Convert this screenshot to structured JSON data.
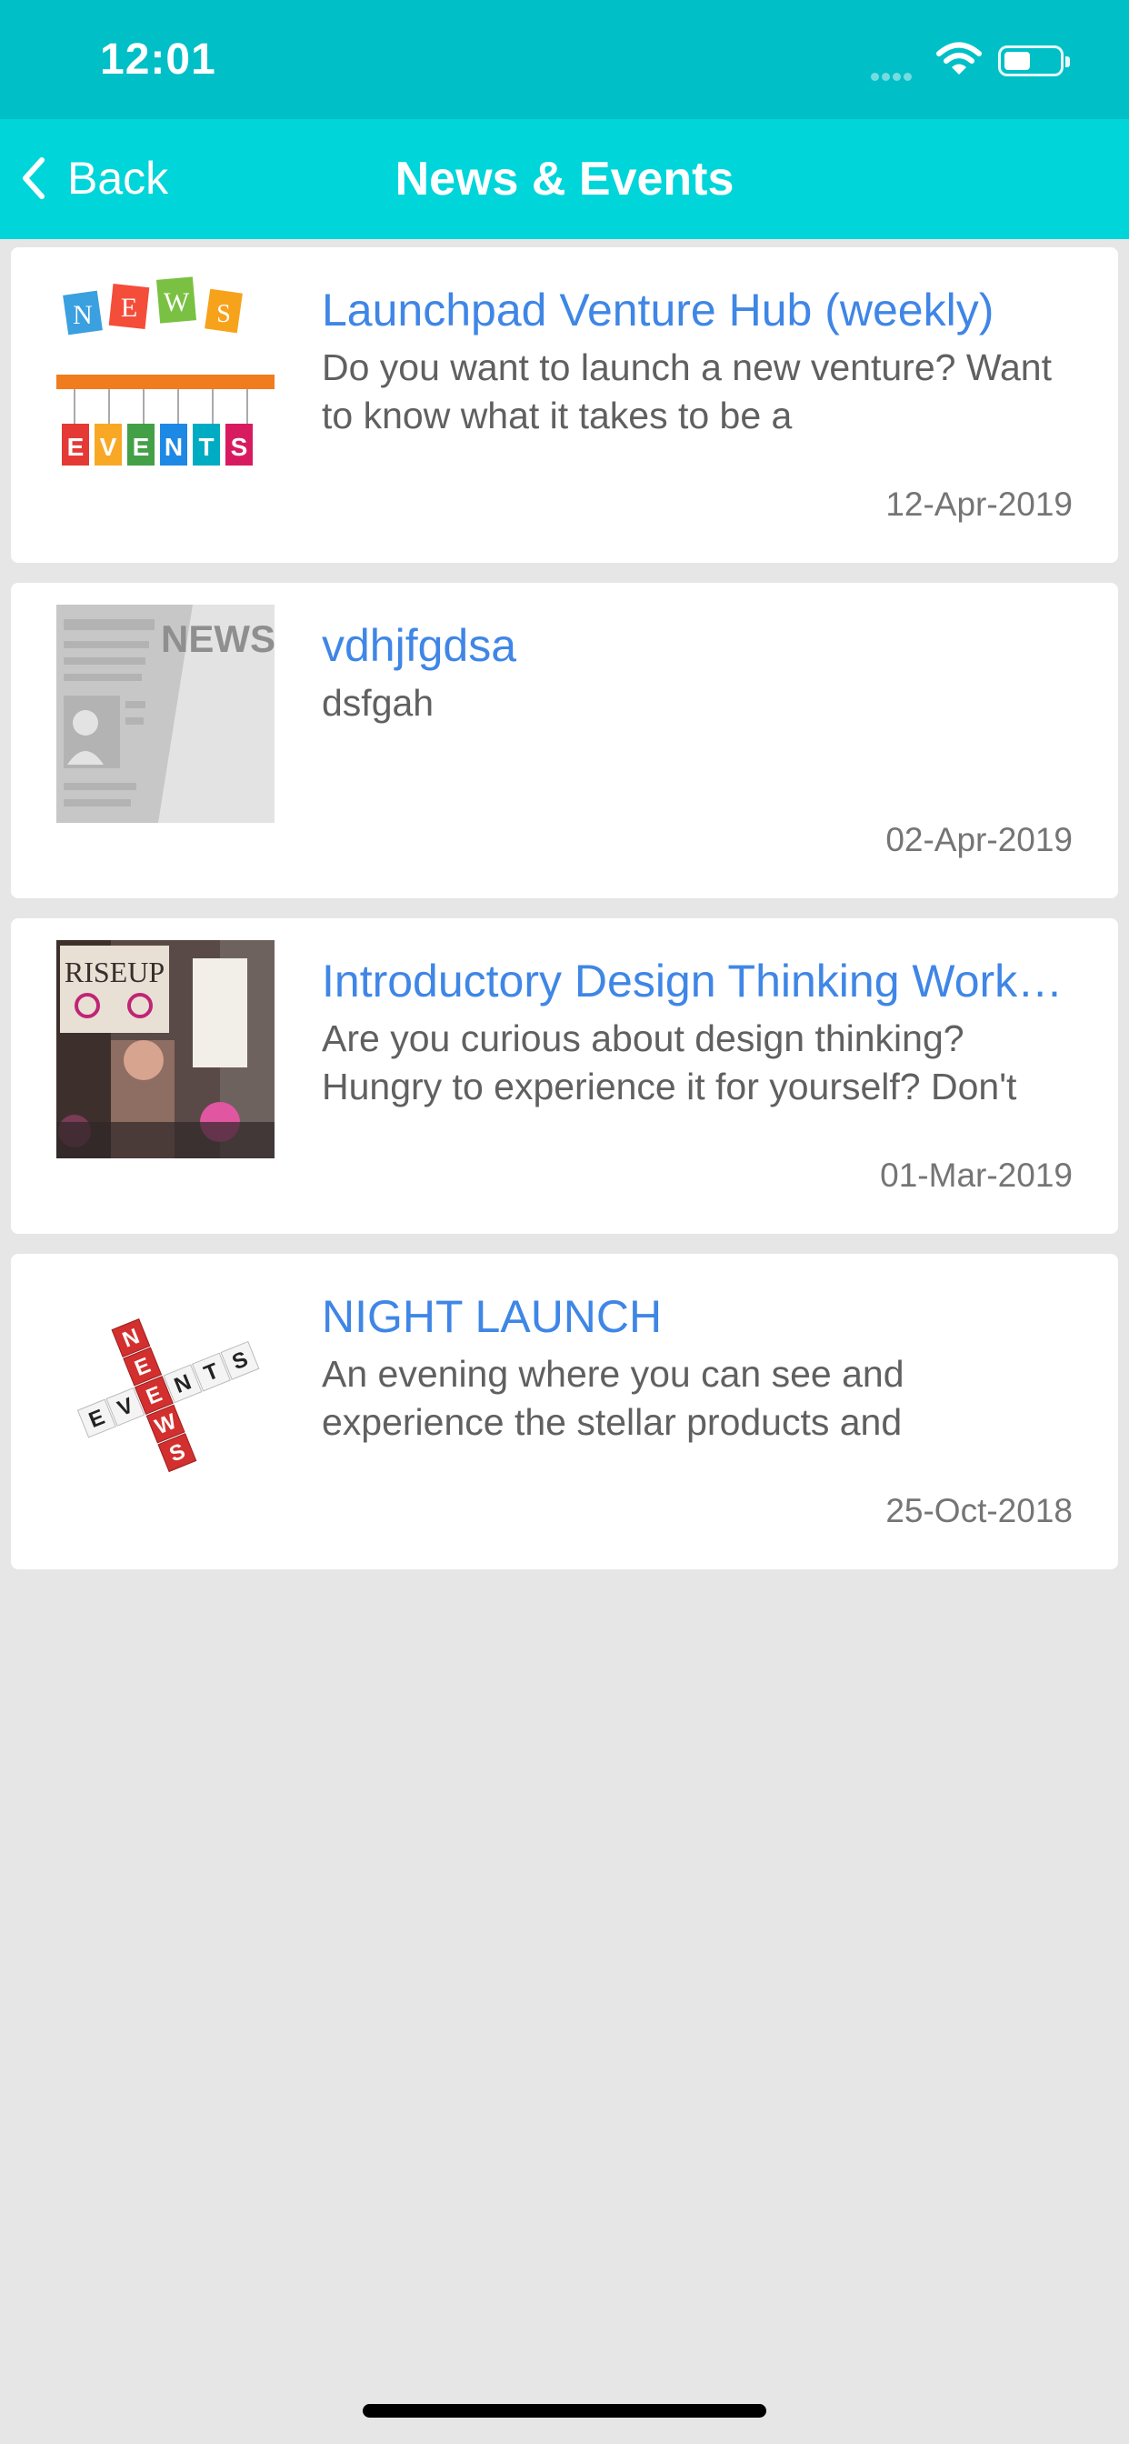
{
  "status_bar": {
    "time": "12:01"
  },
  "nav": {
    "back_label": "Back",
    "title": "News & Events"
  },
  "items": [
    {
      "title": "Launchpad Venture Hub (weekly)",
      "description": "Do you want to launch a new venture? Want to know what it takes to be a",
      "date": "12-Apr-2019",
      "image_icon": "news-and-events-icon"
    },
    {
      "title": "vdhjfgdsa",
      "description": "dsfgah",
      "date": "02-Apr-2019",
      "image_icon": "newspaper-icon"
    },
    {
      "title": "Introductory Design Thinking Workshop",
      "description": "Are you curious about design thinking? Hungry to experience it for yourself? Don't",
      "date": "01-Mar-2019",
      "image_icon": "protest-photo"
    },
    {
      "title": "NIGHT LAUNCH",
      "description": "An evening where you can see and experience the stellar products and",
      "date": "25-Oct-2018",
      "image_icon": "news-events-crossword-icon"
    }
  ],
  "logo_text": {
    "news_letters": [
      "N",
      "E",
      "W",
      "S"
    ],
    "events_letters": [
      "E",
      "V",
      "E",
      "N",
      "T",
      "S"
    ],
    "newspaper_word": "NEWS",
    "sign_text": "RISEUP"
  }
}
